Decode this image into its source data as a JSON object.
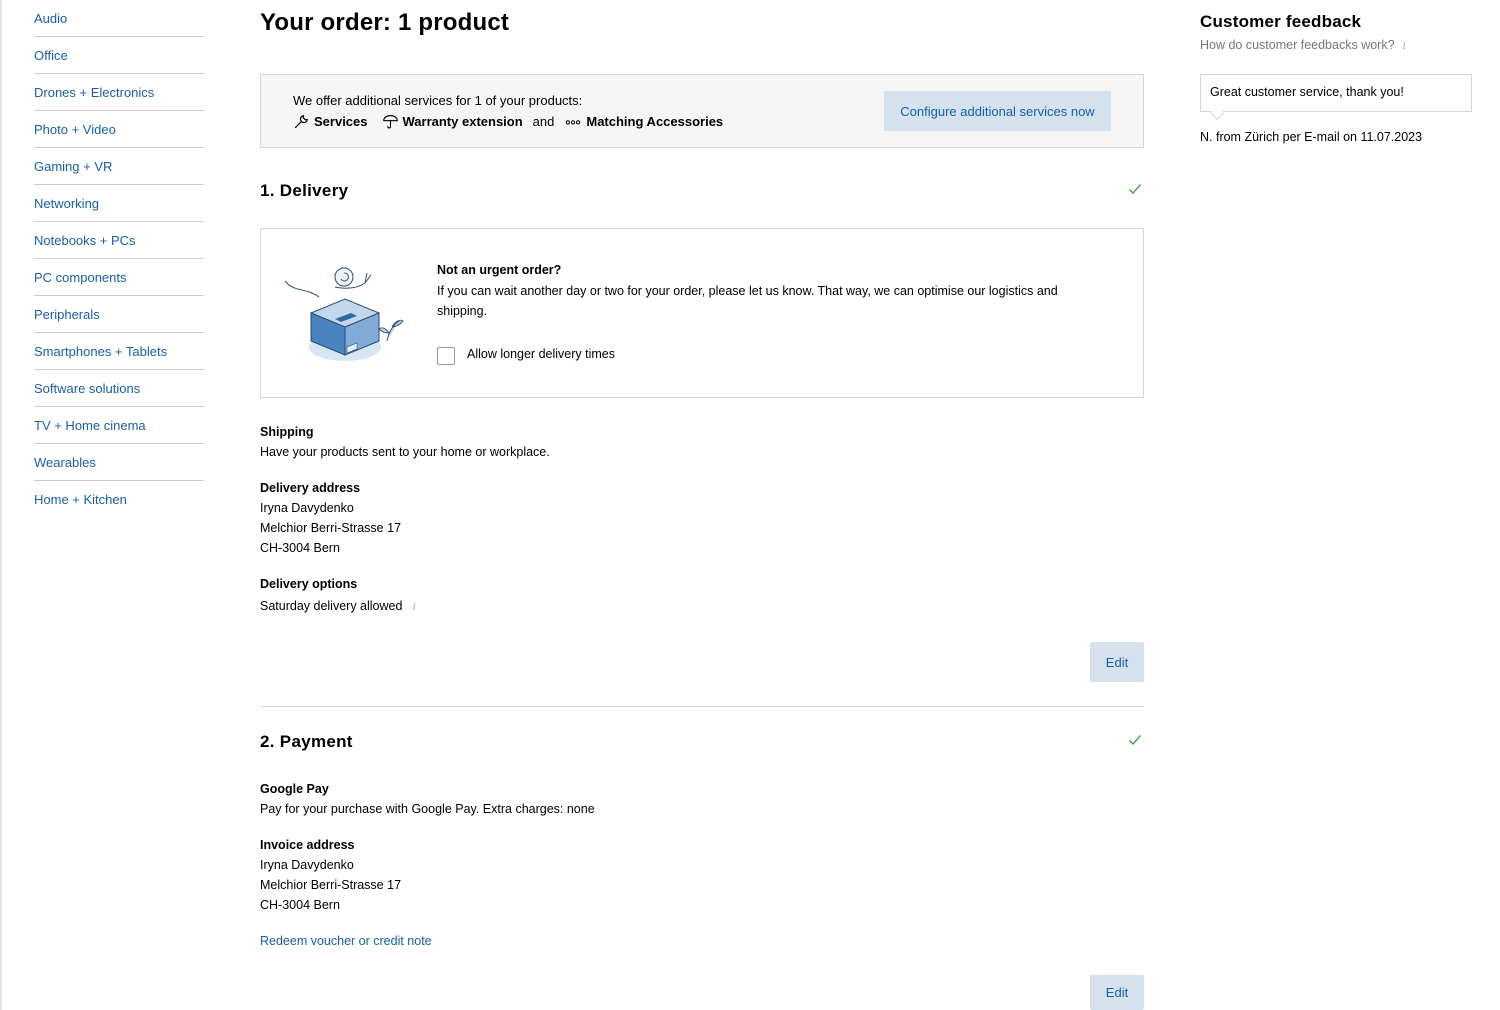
{
  "sidebar": {
    "items": [
      {
        "label": "Audio"
      },
      {
        "label": "Office"
      },
      {
        "label": "Drones + Electronics"
      },
      {
        "label": "Photo + Video"
      },
      {
        "label": "Gaming + VR"
      },
      {
        "label": "Networking"
      },
      {
        "label": "Notebooks + PCs"
      },
      {
        "label": "PC components"
      },
      {
        "label": "Peripherals"
      },
      {
        "label": "Smartphones + Tablets"
      },
      {
        "label": "Software solutions"
      },
      {
        "label": "TV + Home cinema"
      },
      {
        "label": "Wearables"
      },
      {
        "label": "Home + Kitchen"
      }
    ]
  },
  "main": {
    "title": "Your order: 1 product",
    "services": {
      "intro": "We offer additional services for 1 of your products:",
      "service_1": "Services",
      "service_2": "Warranty extension",
      "and": "and",
      "service_3": "Matching Accessories",
      "configure_label": "Configure additional services now"
    },
    "delivery": {
      "title": "1. Delivery",
      "urgent_title": "Not an urgent order?",
      "urgent_text": "If you can wait another day or two for your order, please let us know. That way, we can optimise our logistics and shipping.",
      "checkbox_label": "Allow longer delivery times",
      "shipping_label": "Shipping",
      "shipping_text": "Have your products sent to your home or workplace.",
      "address_label": "Delivery address",
      "address_name": "Iryna Davydenko",
      "address_street": "Melchior Berri-Strasse 17",
      "address_city": "CH-3004 Bern",
      "options_label": "Delivery options",
      "options_text": "Saturday delivery allowed",
      "edit_label": "Edit"
    },
    "payment": {
      "title": "2. Payment",
      "method_label": "Google Pay",
      "method_text": "Pay for your purchase with Google Pay. Extra charges: none",
      "invoice_label": "Invoice address",
      "invoice_name": "Iryna Davydenko",
      "invoice_street": "Melchior Berri-Strasse 17",
      "invoice_city": "CH-3004 Bern",
      "voucher_link": "Redeem voucher or credit note",
      "edit_label": "Edit"
    }
  },
  "feedback": {
    "title": "Customer feedback",
    "subtitle": "How do customer feedbacks work?",
    "info": "i",
    "quote": "Great customer service, thank you!",
    "author": "N. from Zürich per E-mail on 11.07.2023"
  },
  "icons": {
    "info": "i",
    "check_color": "#3a9a3a",
    "accent": "#1a5ea8",
    "button_bg": "#d5e1ec"
  }
}
